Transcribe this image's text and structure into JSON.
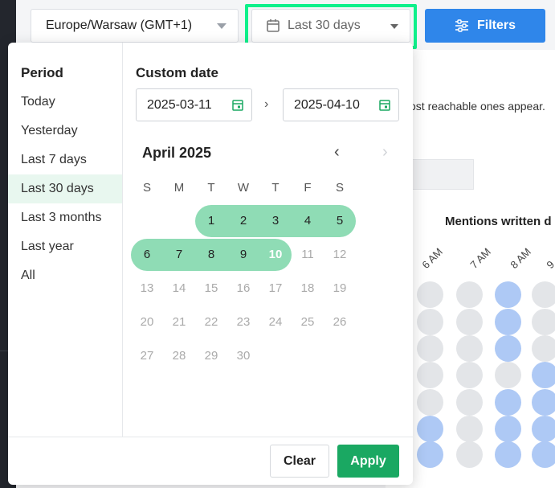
{
  "toolbar": {
    "timezone": "Europe/Warsaw (GMT+1)",
    "range_label": "Last 30 days",
    "filters_label": "Filters"
  },
  "background": {
    "hint_text": "ost reachable ones appear.",
    "chart_title": "Mentions written d",
    "hour_labels": [
      "6 AM",
      "7 AM",
      "8 AM",
      "9"
    ]
  },
  "picker": {
    "period_title": "Period",
    "periods": [
      "Today",
      "Yesterday",
      "Last 7 days",
      "Last 30 days",
      "Last 3 months",
      "Last year",
      "All"
    ],
    "active_period": "Last 30 days",
    "custom_title": "Custom date",
    "start_date": "2025-03-11",
    "end_date": "2025-04-10",
    "month_label": "April 2025",
    "weekdays": [
      "S",
      "M",
      "T",
      "W",
      "T",
      "F",
      "S"
    ],
    "weeks": [
      [
        "",
        "",
        "1",
        "2",
        "3",
        "4",
        "5"
      ],
      [
        "6",
        "7",
        "8",
        "9",
        "10",
        "11",
        "12"
      ],
      [
        "13",
        "14",
        "15",
        "16",
        "17",
        "18",
        "19"
      ],
      [
        "20",
        "21",
        "22",
        "23",
        "24",
        "25",
        "26"
      ],
      [
        "27",
        "28",
        "29",
        "30",
        "",
        "",
        ""
      ]
    ],
    "selected_day": "10",
    "clear_label": "Clear",
    "apply_label": "Apply"
  },
  "colors": {
    "accent_green": "#1aa862",
    "range_green": "#8fdcb5",
    "filters_blue": "#2f86ea",
    "highlight_green": "#0ef08b"
  }
}
